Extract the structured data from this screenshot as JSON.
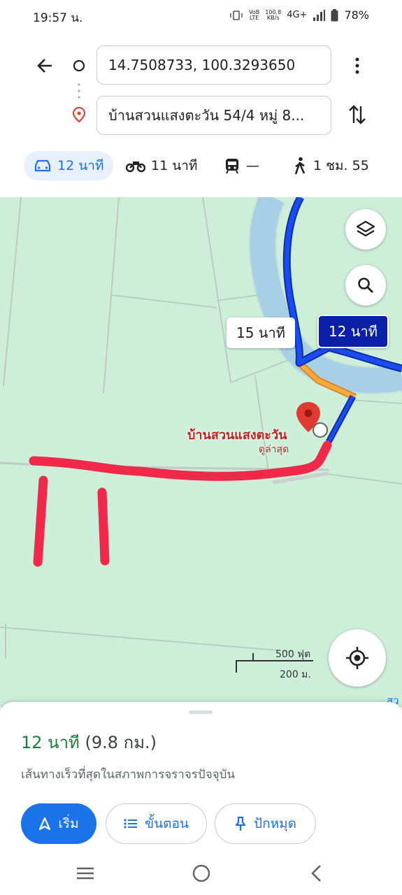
{
  "status": {
    "time": "19:57 น.",
    "net_top": "100.8",
    "net_bottom": "KB/s",
    "network": "4G+",
    "battery": "78%",
    "volte_top": "VoB",
    "volte_bottom": "LTE"
  },
  "route": {
    "origin": "14.7508733, 100.3293650",
    "destination": "บ้านสวนแสงตะวัน 54/4 หมู่ 8..."
  },
  "modes": [
    {
      "label": "12 นาที",
      "icon": "car-icon"
    },
    {
      "label": "11 นาที",
      "icon": "motorcycle-icon"
    },
    {
      "label": "—",
      "icon": "transit-icon"
    },
    {
      "label": "1 ชม. 55",
      "icon": "walk-icon"
    }
  ],
  "map": {
    "alt_route_time": "15 นาที",
    "selected_route_time": "12 นาที",
    "place_name": "บ้านสวนแสงตะวัน",
    "place_sub": "ดูล่าสุด",
    "scale_ft": "500 ฟุต",
    "scale_m": "200 ม.",
    "edge_label": "สว"
  },
  "sheet": {
    "duration": "12 นาที",
    "distance": "(9.8 กม.)",
    "description": "เส้นทางเร็วที่สุดในสภาพการจราจรปัจจุบัน",
    "start_label": "เริ่ม",
    "steps_label": "ขั้นตอน",
    "pin_label": "ปักหมุด"
  },
  "colors": {
    "accent": "#1a73e8",
    "route": "#1133dd",
    "alt_route": "#f2a230",
    "river": "#a6dcef",
    "map_bg": "#cdefd9",
    "marker": "#ea4335",
    "annotation": "#f0284a",
    "duration_green": "#188038"
  }
}
